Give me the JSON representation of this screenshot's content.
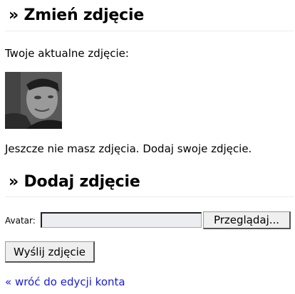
{
  "change_photo": {
    "heading": "» Zmień zdjęcie",
    "current_label": "Twoje aktualne zdjęcie:",
    "no_photo_text": "Jeszcze nie masz zdjęcia. Dodaj swoje zdjęcie."
  },
  "add_photo": {
    "heading": "» Dodaj zdjęcie",
    "avatar_label": "Avatar:",
    "file_value": "",
    "browse_label": "Przeglądaj...",
    "submit_label": "Wyślij zdjęcie"
  },
  "back_link": "« wróć do edycji konta",
  "colors": {
    "link": "#1a1ad6",
    "rule": "#ececec",
    "input_bg": "#ecedf0"
  }
}
